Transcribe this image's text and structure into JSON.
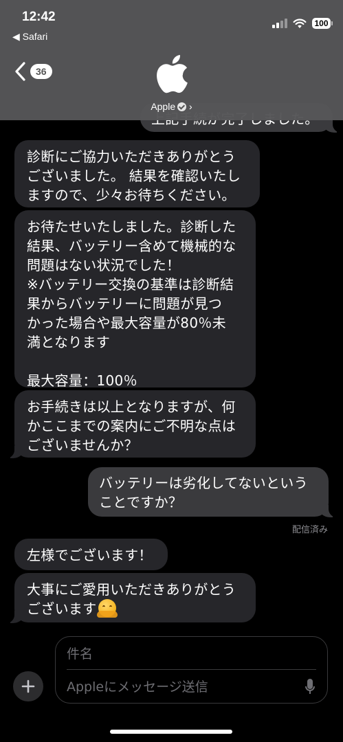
{
  "status_bar": {
    "time": "12:42",
    "back_app": "◀ Safari",
    "battery": "100"
  },
  "header": {
    "back_count": "36",
    "contact_name": "Apple",
    "contact_chevron": "›"
  },
  "messages": [
    {
      "side": "out",
      "text": "上記手続が完了しました。"
    },
    {
      "side": "in",
      "text": "診断にご協力いただきありがとう\nございました。 結果を確認いたし\nますので、少々お待ちください。"
    },
    {
      "side": "in",
      "text": "お待たせいたしました。診断した\n結果、バッテリー含めて機械的な\n問題はない状況でした！\n※バッテリー交換の基準は診断結\n果からバッテリーに問題が見つ\nかった場合や最大容量が80％未\n満となります\n\n最大容量：100％"
    },
    {
      "side": "in",
      "text": "お手続きは以上となりますが、何\nかここまでの案内にご不明な点は\nございませんか？"
    },
    {
      "side": "out",
      "text": "バッテリーは劣化してないという\nことですか？"
    },
    {
      "side": "in",
      "text": "左様でございます！"
    },
    {
      "side": "in",
      "text": "大事にご愛用いただきありがとう\nございます"
    }
  ],
  "delivered_label": "配信済み",
  "compose": {
    "subject_placeholder": "件名",
    "message_placeholder": "Appleにメッセージ送信"
  },
  "colors": {
    "incoming_bubble": "#26262a",
    "outgoing_bubble": "#3a3a3d",
    "header_bg": "#565658"
  }
}
